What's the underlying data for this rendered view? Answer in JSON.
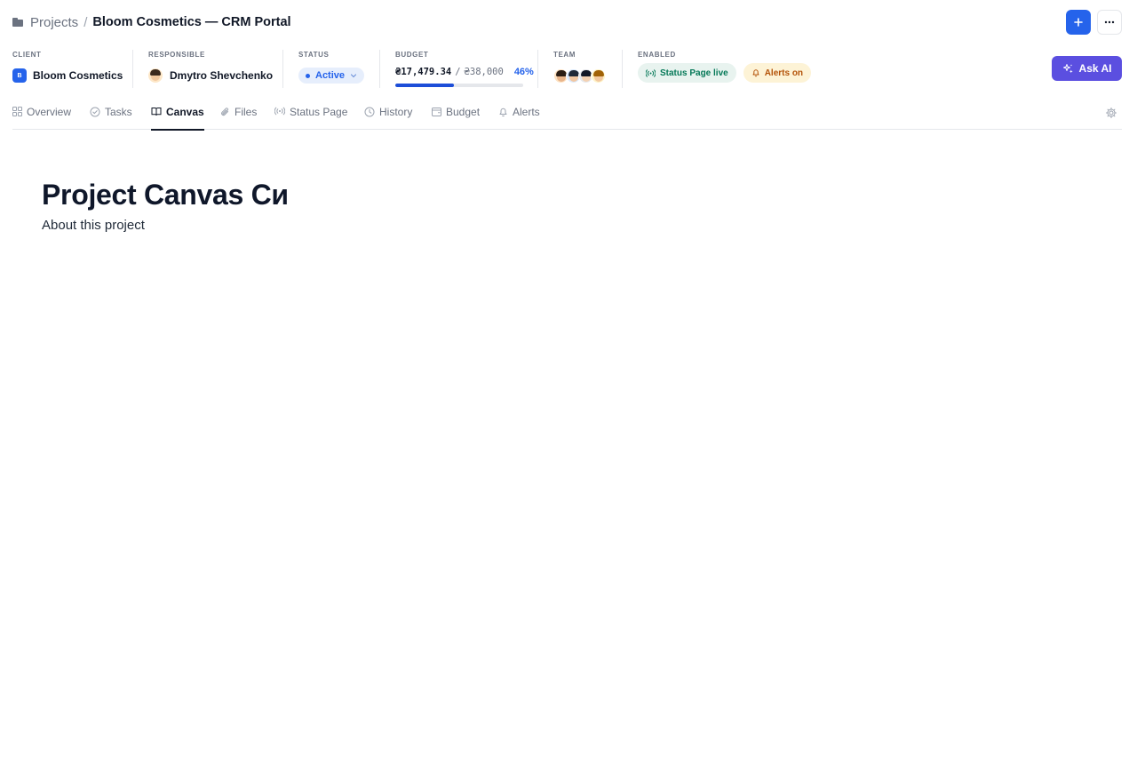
{
  "breadcrumb": {
    "root": "Projects",
    "separator": "/",
    "current": "Bloom Cosmetics — CRM Portal"
  },
  "meta": {
    "client": {
      "label": "CLIENT",
      "badge": "B",
      "name": "Bloom Cosmetics"
    },
    "responsible": {
      "label": "RESPONSIBLE",
      "name": "Dmytro Shevchenko"
    },
    "status": {
      "label": "STATUS",
      "value": "Active"
    },
    "budget": {
      "label": "BUDGET",
      "spent": "₴17,479.34",
      "separator": "/",
      "total": "₴38,000",
      "percent_text": "46%",
      "progress": 0.46
    },
    "team": {
      "label": "TEAM",
      "member_count": 4
    },
    "enabled": {
      "label": "ENABLED",
      "status_page": "Status Page live",
      "alerts": "Alerts on"
    }
  },
  "actions": {
    "ask_ai": "Ask AI"
  },
  "tabs": [
    {
      "label": "Overview",
      "icon": "grid-icon",
      "active": false
    },
    {
      "label": "Tasks",
      "icon": "check-circle-icon",
      "active": false
    },
    {
      "label": "Canvas",
      "icon": "book-icon",
      "active": true
    },
    {
      "label": "Files",
      "icon": "paperclip-icon",
      "active": false
    },
    {
      "label": "Status Page",
      "icon": "broadcast-icon",
      "active": false
    },
    {
      "label": "History",
      "icon": "clock-icon",
      "active": false
    },
    {
      "label": "Budget",
      "icon": "wallet-icon",
      "active": false
    },
    {
      "label": "Alerts",
      "icon": "bell-icon",
      "active": false
    }
  ],
  "canvas": {
    "title": "Project Canvas Си",
    "subtitle": "About this project"
  },
  "colors": {
    "accent": "#2563eb",
    "ai": "#5b4fe0",
    "success": "#047857",
    "warning": "#b45309"
  }
}
